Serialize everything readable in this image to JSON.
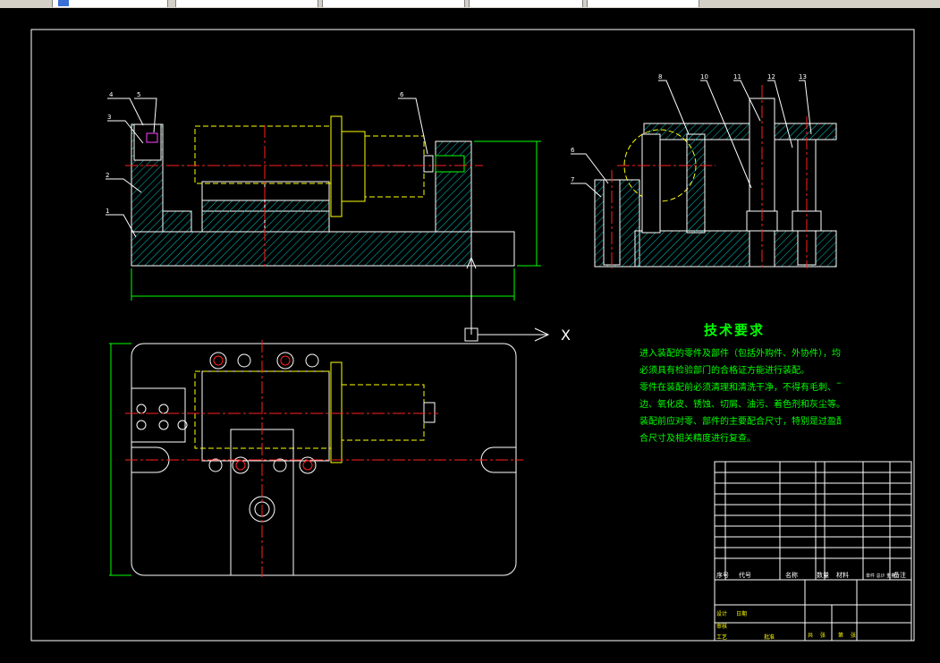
{
  "axis": {
    "x_label": "X"
  },
  "tech_requirements": {
    "title": "技术要求",
    "lines": [
      "进入装配的零件及部件（包括外购件、外协件），均",
      "必须具有检验部门的合格证方能进行装配。",
      "零件在装配前必须清理和清洗干净，不得有毛刺、飞",
      "边、氧化皮、锈蚀、切屑、油污、着色剂和灰尘等。",
      "装配前应对零、部件的主要配合尺寸，特别是过盈配",
      "合尺寸及相关精度进行复查。"
    ]
  },
  "callouts": {
    "front_view": [
      "4",
      "5",
      "3",
      "2",
      "1",
      "6"
    ],
    "side_view": [
      "8",
      "6",
      "7",
      "10",
      "11",
      "12",
      "13"
    ]
  },
  "title_block": {
    "header": [
      "序号",
      "代号",
      "名称",
      "数量",
      "材料",
      "单件 总计 重量",
      "备注"
    ],
    "approval": [
      "设计",
      "审核",
      "工艺",
      "批准",
      "日期"
    ],
    "footer": [
      "共",
      "张",
      "第",
      "张"
    ]
  },
  "colors": {
    "outline": "#ffffff",
    "hatch": "#00c8c8",
    "centerline": "#ff2020",
    "dimension": "#00ff00",
    "yellow": "#ffff00",
    "magenta": "#ff40ff",
    "text_green": "#00ff00"
  }
}
